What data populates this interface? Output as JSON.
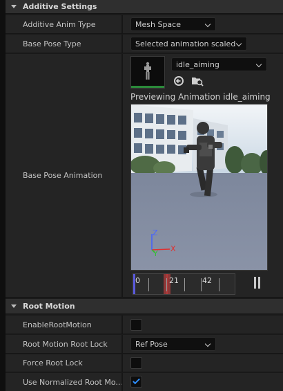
{
  "additive_settings": {
    "header": "Additive Settings",
    "anim_type": {
      "label": "Additive Anim Type",
      "value": "Mesh Space"
    },
    "base_pose_type": {
      "label": "Base Pose Type",
      "value": "Selected animation scaled"
    },
    "base_pose_animation": {
      "label": "Base Pose Animation",
      "asset": "idle_aiming",
      "preview_text": "Previewing Animation idle_aiming",
      "timeline": {
        "markers": [
          "0",
          "21",
          "42"
        ],
        "playhead_frame": 21,
        "total_frames": 42
      }
    }
  },
  "root_motion": {
    "header": "Root Motion",
    "enable": {
      "label": "EnableRootMotion",
      "checked": false
    },
    "root_lock": {
      "label": "Root Motion Root Lock",
      "value": "Ref Pose"
    },
    "force_root_lock": {
      "label": "Force Root Lock",
      "checked": false
    },
    "normalized": {
      "label": "Use Normalized Root Mo...",
      "checked": true
    }
  },
  "axes": {
    "x": "X",
    "y": "Y",
    "z": "Z"
  },
  "colors": {
    "accent_check": "#2e8fff",
    "playhead": "#b13a3a",
    "axis_x": "#e03030",
    "axis_y": "#30c030",
    "axis_z": "#4060ff"
  }
}
